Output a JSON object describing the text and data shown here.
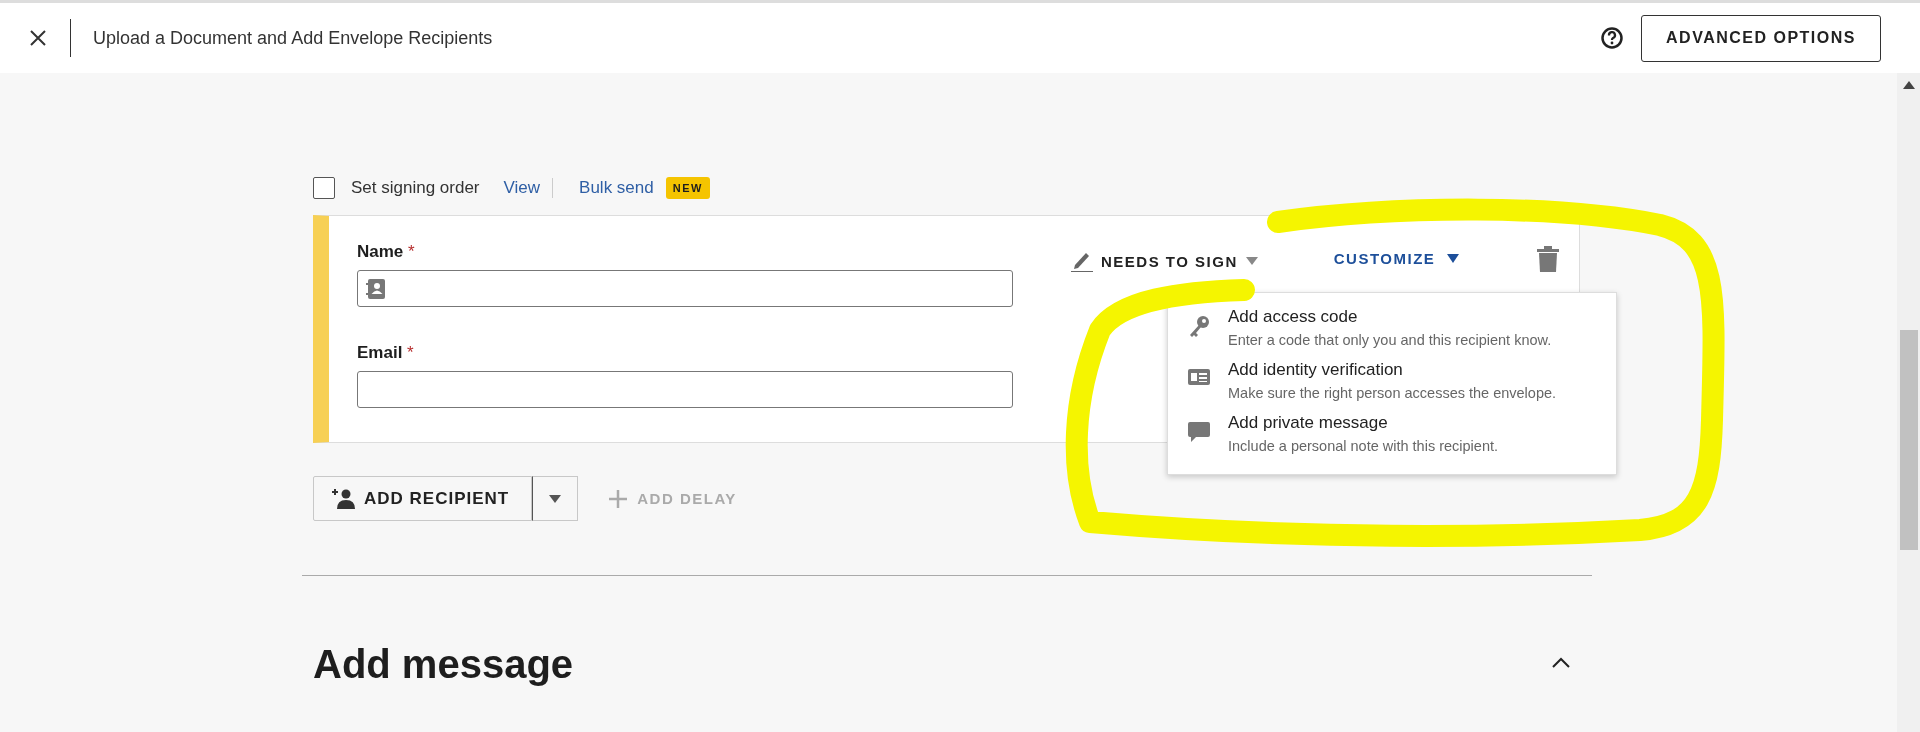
{
  "header": {
    "title": "Upload a Document and Add Envelope Recipients",
    "action": "ADVANCED OPTIONS"
  },
  "options": {
    "signing_order": {
      "label": "Set signing order",
      "checked": false
    },
    "links": [
      "View",
      "Bulk send"
    ],
    "badge": "NEW"
  },
  "recipient": {
    "fields": [
      {
        "label": "Name",
        "required_mark": "*",
        "kind": "contact"
      },
      {
        "label": "Email",
        "required_mark": "*",
        "kind": "plain"
      }
    ],
    "role": "NEEDS TO SIGN",
    "customize": "CUSTOMIZE"
  },
  "customize_menu": [
    {
      "kind": "key",
      "title": "Add access code",
      "description": "Enter a code that only you and this recipient know."
    },
    {
      "kind": "id-card",
      "title": "Add identity verification",
      "description": "Make sure the right person accesses the envelope."
    },
    {
      "kind": "speech-bubble",
      "title": "Add private message",
      "description": "Include a personal note with this recipient."
    }
  ],
  "add_recipient": "ADD RECIPIENT",
  "add_delay": {
    "label": "ADD DELAY",
    "disabled": true
  },
  "sections": [
    {
      "title": "Add message",
      "expanded": true
    }
  ]
}
